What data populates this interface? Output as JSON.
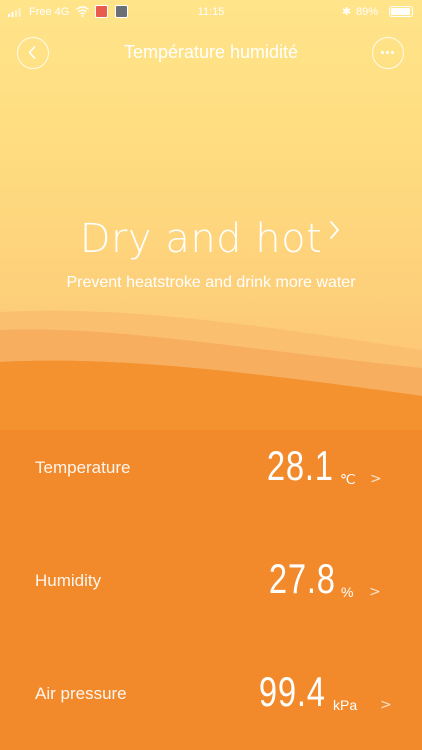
{
  "status_bar": {
    "carrier": "Free 4G",
    "time": "11:15",
    "battery": "89%"
  },
  "header": {
    "title": "Température humidité"
  },
  "summary": {
    "title": "Dry and hot",
    "subtitle": "Prevent heatstroke and drink more water"
  },
  "metrics": [
    {
      "label": "Temperature",
      "value": "28.1",
      "unit": "℃",
      "chevron": ">"
    },
    {
      "label": "Humidity",
      "value": "27.8",
      "unit": "%",
      "chevron": ">"
    },
    {
      "label": "Air pressure",
      "value": "99.4",
      "unit": "kPa",
      "chevron": ">"
    }
  ],
  "colors": {
    "sky_top": "#ffe48a",
    "sky_bottom": "#fdc777",
    "wave_light": "#f7ae5e",
    "wave_mid": "#f59a45",
    "panel": "#f28a2c"
  }
}
